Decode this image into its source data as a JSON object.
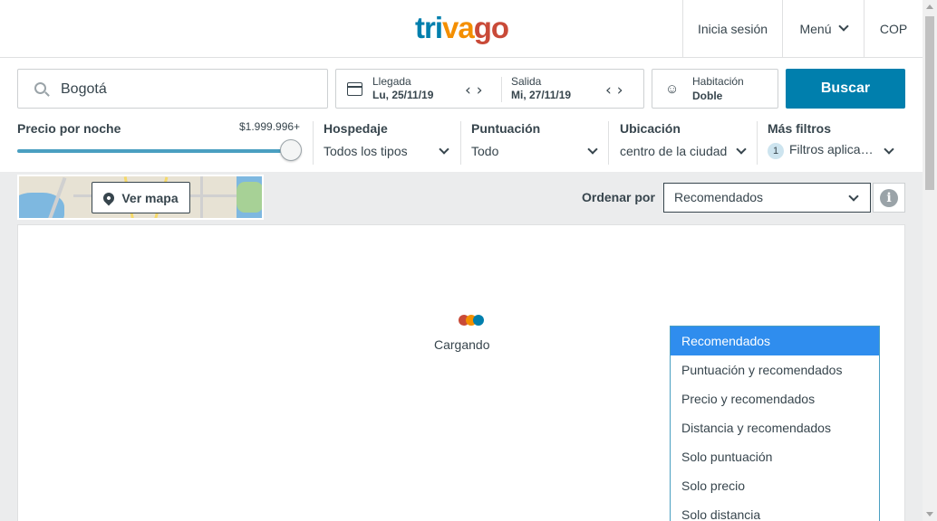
{
  "header": {
    "logo": {
      "part1": "tri",
      "part2": "va",
      "part3": "go"
    },
    "login": "Inicia sesión",
    "menu": "Menú",
    "currency": "COP"
  },
  "search": {
    "destination": "Bogotá",
    "checkin_label": "Llegada",
    "checkin_value": "Lu, 25/11/19",
    "checkout_label": "Salida",
    "checkout_value": "Mi, 27/11/19",
    "room_label": "Habitación",
    "room_value": "Doble",
    "search_button": "Buscar"
  },
  "filters": {
    "price_label": "Precio por noche",
    "price_value": "$1.999.996+",
    "price_fraction": 1.0,
    "lodging_title": "Hospedaje",
    "lodging_value": "Todos los tipos",
    "rating_title": "Puntuación",
    "rating_value": "Todo",
    "location_title": "Ubicación",
    "location_value": "centro de la ciudad",
    "more_title": "Más filtros",
    "more_count": "1",
    "more_value": "Filtros aplica…"
  },
  "map": {
    "button": "Ver mapa"
  },
  "sort": {
    "label": "Ordenar por",
    "selected": "Recomendados",
    "options": [
      "Recomendados",
      "Puntuación y recomendados",
      "Precio y recomendados",
      "Distancia y recomendados",
      "Solo puntuación",
      "Solo precio",
      "Solo distancia"
    ]
  },
  "results": {
    "loading": "Cargando"
  },
  "colors": {
    "brand_blue": "#007fad",
    "brand_orange": "#f48f00",
    "brand_red": "#c94a38",
    "dropdown_selected": "#2f8dee"
  }
}
